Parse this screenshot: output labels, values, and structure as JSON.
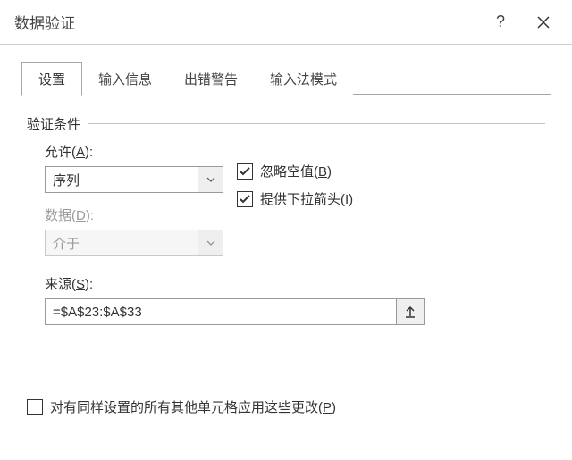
{
  "title": "数据验证",
  "titlebar": {
    "help": "?",
    "close": "×"
  },
  "tabs": [
    {
      "label": "设置"
    },
    {
      "label": "输入信息"
    },
    {
      "label": "出错警告"
    },
    {
      "label": "输入法模式"
    }
  ],
  "group": {
    "label": "验证条件"
  },
  "allow": {
    "label_pre": "允许(",
    "label_key": "A",
    "label_post": "):",
    "value": "序列"
  },
  "data_field": {
    "label_pre": "数据(",
    "label_key": "D",
    "label_post": "):",
    "value": "介于"
  },
  "ignore_blank": {
    "pre": "忽略空值(",
    "key": "B",
    "post": ")",
    "checked": true
  },
  "dropdown": {
    "pre": "提供下拉箭头(",
    "key": "I",
    "post": ")",
    "checked": true
  },
  "source": {
    "label_pre": "来源(",
    "label_key": "S",
    "label_post": "):",
    "value": "=$A$23:$A$33"
  },
  "apply_all": {
    "pre": "对有同样设置的所有其他单元格应用这些更改(",
    "key": "P",
    "post": ")",
    "checked": false
  }
}
